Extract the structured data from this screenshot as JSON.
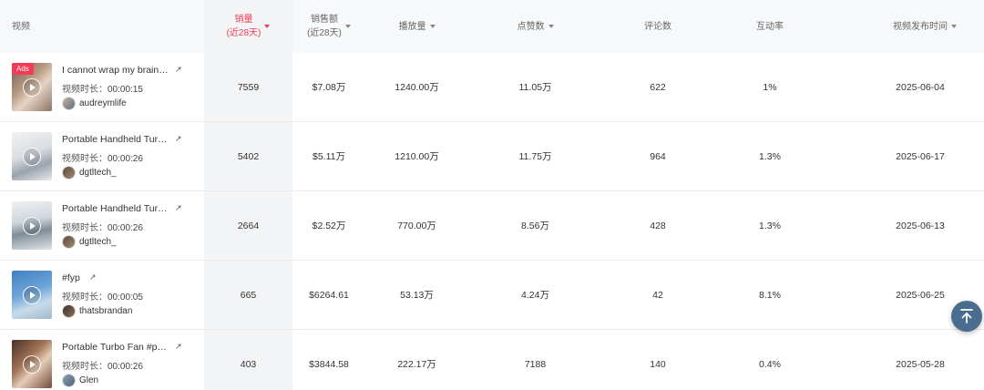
{
  "columns": [
    {
      "label": "视频"
    },
    {
      "label": "销量\n(近28天)",
      "sorted": true
    },
    {
      "label": "销售额\n(近28天)"
    },
    {
      "label": "播放量"
    },
    {
      "label": "点赞数"
    },
    {
      "label": "评论数"
    },
    {
      "label": "互动率"
    },
    {
      "label": "视频发布时间"
    }
  ],
  "duration_label": "视频时长：",
  "rows": [
    {
      "ads": "Ads",
      "title": "I cannot wrap my brain…",
      "duration": "00:00:15",
      "author": "audreymlife",
      "sales": "7559",
      "revenue": "$7.08万",
      "plays": "1240.00万",
      "likes": "11.05万",
      "comments": "622",
      "engagement": "1%",
      "date": "2025-06-04"
    },
    {
      "title": "Portable Handheld Tur…",
      "duration": "00:00:26",
      "author": "dgtltech_",
      "sales": "5402",
      "revenue": "$5.11万",
      "plays": "1210.00万",
      "likes": "11.75万",
      "comments": "964",
      "engagement": "1.3%",
      "date": "2025-06-17"
    },
    {
      "title": "Portable Handheld Tur…",
      "duration": "00:00:26",
      "author": "dgtltech_",
      "sales": "2664",
      "revenue": "$2.52万",
      "plays": "770.00万",
      "likes": "8.56万",
      "comments": "428",
      "engagement": "1.3%",
      "date": "2025-06-13"
    },
    {
      "title": "#fyp",
      "duration": "00:00:05",
      "author": "thatsbrandan",
      "sales": "665",
      "revenue": "$6264.61",
      "plays": "53.13万",
      "likes": "4.24万",
      "comments": "42",
      "engagement": "8.1%",
      "date": "2025-06-25"
    },
    {
      "title": "Portable Turbo Fan #p…",
      "duration": "00:00:26",
      "author": "Glen",
      "sales": "403",
      "revenue": "$3844.58",
      "plays": "222.17万",
      "likes": "7188",
      "comments": "140",
      "engagement": "0.4%",
      "date": "2025-05-28"
    }
  ]
}
